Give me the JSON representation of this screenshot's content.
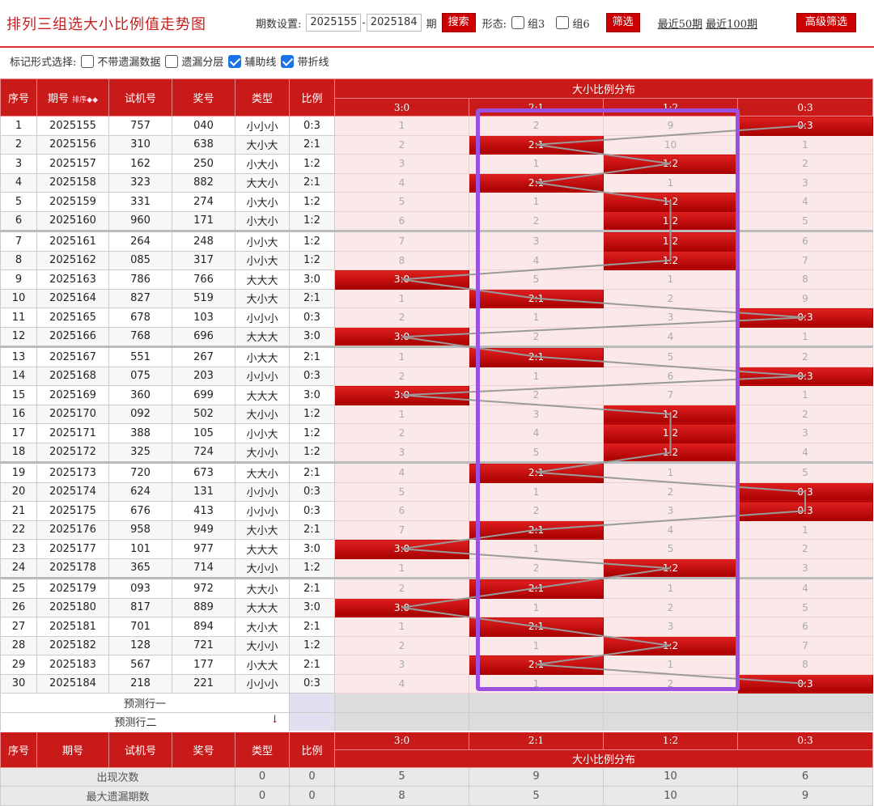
{
  "header": {
    "title": "排列三组选大小比例值走势图",
    "period_label": "期数设置:",
    "period_from": "2025155",
    "period_sep": "-",
    "period_to": "2025184",
    "period_unit": "期",
    "search_label": "搜索",
    "shape_label": "形态:",
    "group3_label": "组3",
    "group6_label": "组6",
    "filter_label": "筛选",
    "recent50_label": "最近50期",
    "recent100_label": "最近100期",
    "advanced_label": "高级筛选"
  },
  "options": {
    "label": "标记形式选择:",
    "items": [
      {
        "label": "不带遗漏数据",
        "checked": false
      },
      {
        "label": "遗漏分层",
        "checked": false
      },
      {
        "label": "辅助线",
        "checked": true
      },
      {
        "label": "带折线",
        "checked": true
      }
    ]
  },
  "columns": {
    "seq": "序号",
    "period": "期号",
    "sort": "排序",
    "test": "试机号",
    "draw": "奖号",
    "type": "类型",
    "ratio": "比例",
    "dist_title": "大小比例分布",
    "dist_cols": [
      "3:0",
      "2:1",
      "1:2",
      "0:3"
    ]
  },
  "rows": [
    {
      "seq": "1",
      "period": "2025155",
      "test": "757",
      "draw": "040",
      "type": "小小小",
      "ratio": "0:3",
      "dist": [
        "1",
        "2",
        "9",
        "0:3"
      ],
      "hit": 3
    },
    {
      "seq": "2",
      "period": "2025156",
      "test": "310",
      "draw": "638",
      "type": "大小大",
      "ratio": "2:1",
      "dist": [
        "2",
        "2:1",
        "10",
        "1"
      ],
      "hit": 1
    },
    {
      "seq": "3",
      "period": "2025157",
      "test": "162",
      "draw": "250",
      "type": "小大小",
      "ratio": "1:2",
      "dist": [
        "3",
        "1",
        "1:2",
        "2"
      ],
      "hit": 2
    },
    {
      "seq": "4",
      "period": "2025158",
      "test": "323",
      "draw": "882",
      "type": "大大小",
      "ratio": "2:1",
      "dist": [
        "4",
        "2:1",
        "1",
        "3"
      ],
      "hit": 1
    },
    {
      "seq": "5",
      "period": "2025159",
      "test": "331",
      "draw": "274",
      "type": "小大小",
      "ratio": "1:2",
      "dist": [
        "5",
        "1",
        "1:2",
        "4"
      ],
      "hit": 2
    },
    {
      "seq": "6",
      "period": "2025160",
      "test": "960",
      "draw": "171",
      "type": "小大小",
      "ratio": "1:2",
      "dist": [
        "6",
        "2",
        "1:2",
        "5"
      ],
      "hit": 2
    },
    {
      "seq": "7",
      "period": "2025161",
      "test": "264",
      "draw": "248",
      "type": "小小大",
      "ratio": "1:2",
      "dist": [
        "7",
        "3",
        "1:2",
        "6"
      ],
      "hit": 2
    },
    {
      "seq": "8",
      "period": "2025162",
      "test": "085",
      "draw": "317",
      "type": "小小大",
      "ratio": "1:2",
      "dist": [
        "8",
        "4",
        "1:2",
        "7"
      ],
      "hit": 2
    },
    {
      "seq": "9",
      "period": "2025163",
      "test": "786",
      "draw": "766",
      "type": "大大大",
      "ratio": "3:0",
      "dist": [
        "3:0",
        "5",
        "1",
        "8"
      ],
      "hit": 0
    },
    {
      "seq": "10",
      "period": "2025164",
      "test": "827",
      "draw": "519",
      "type": "大小大",
      "ratio": "2:1",
      "dist": [
        "1",
        "2:1",
        "2",
        "9"
      ],
      "hit": 1
    },
    {
      "seq": "11",
      "period": "2025165",
      "test": "678",
      "draw": "103",
      "type": "小小小",
      "ratio": "0:3",
      "dist": [
        "2",
        "1",
        "3",
        "0:3"
      ],
      "hit": 3
    },
    {
      "seq": "12",
      "period": "2025166",
      "test": "768",
      "draw": "696",
      "type": "大大大",
      "ratio": "3:0",
      "dist": [
        "3:0",
        "2",
        "4",
        "1"
      ],
      "hit": 0
    },
    {
      "seq": "13",
      "period": "2025167",
      "test": "551",
      "draw": "267",
      "type": "小大大",
      "ratio": "2:1",
      "dist": [
        "1",
        "2:1",
        "5",
        "2"
      ],
      "hit": 1
    },
    {
      "seq": "14",
      "period": "2025168",
      "test": "075",
      "draw": "203",
      "type": "小小小",
      "ratio": "0:3",
      "dist": [
        "2",
        "1",
        "6",
        "0:3"
      ],
      "hit": 3
    },
    {
      "seq": "15",
      "period": "2025169",
      "test": "360",
      "draw": "699",
      "type": "大大大",
      "ratio": "3:0",
      "dist": [
        "3:0",
        "2",
        "7",
        "1"
      ],
      "hit": 0
    },
    {
      "seq": "16",
      "period": "2025170",
      "test": "092",
      "draw": "502",
      "type": "大小小",
      "ratio": "1:2",
      "dist": [
        "1",
        "3",
        "1:2",
        "2"
      ],
      "hit": 2
    },
    {
      "seq": "17",
      "period": "2025171",
      "test": "388",
      "draw": "105",
      "type": "小小大",
      "ratio": "1:2",
      "dist": [
        "2",
        "4",
        "1:2",
        "3"
      ],
      "hit": 2
    },
    {
      "seq": "18",
      "period": "2025172",
      "test": "325",
      "draw": "724",
      "type": "大小小",
      "ratio": "1:2",
      "dist": [
        "3",
        "5",
        "1:2",
        "4"
      ],
      "hit": 2
    },
    {
      "seq": "19",
      "period": "2025173",
      "test": "720",
      "draw": "673",
      "type": "大大小",
      "ratio": "2:1",
      "dist": [
        "4",
        "2:1",
        "1",
        "5"
      ],
      "hit": 1
    },
    {
      "seq": "20",
      "period": "2025174",
      "test": "624",
      "draw": "131",
      "type": "小小小",
      "ratio": "0:3",
      "dist": [
        "5",
        "1",
        "2",
        "0:3"
      ],
      "hit": 3
    },
    {
      "seq": "21",
      "period": "2025175",
      "test": "676",
      "draw": "413",
      "type": "小小小",
      "ratio": "0:3",
      "dist": [
        "6",
        "2",
        "3",
        "0:3"
      ],
      "hit": 3
    },
    {
      "seq": "22",
      "period": "2025176",
      "test": "958",
      "draw": "949",
      "type": "大小大",
      "ratio": "2:1",
      "dist": [
        "7",
        "2:1",
        "4",
        "1"
      ],
      "hit": 1
    },
    {
      "seq": "23",
      "period": "2025177",
      "test": "101",
      "draw": "977",
      "type": "大大大",
      "ratio": "3:0",
      "dist": [
        "3:0",
        "1",
        "5",
        "2"
      ],
      "hit": 0
    },
    {
      "seq": "24",
      "period": "2025178",
      "test": "365",
      "draw": "714",
      "type": "大小小",
      "ratio": "1:2",
      "dist": [
        "1",
        "2",
        "1:2",
        "3"
      ],
      "hit": 2
    },
    {
      "seq": "25",
      "period": "2025179",
      "test": "093",
      "draw": "972",
      "type": "大大小",
      "ratio": "2:1",
      "dist": [
        "2",
        "2:1",
        "1",
        "4"
      ],
      "hit": 1
    },
    {
      "seq": "26",
      "period": "2025180",
      "test": "817",
      "draw": "889",
      "type": "大大大",
      "ratio": "3:0",
      "dist": [
        "3:0",
        "1",
        "2",
        "5"
      ],
      "hit": 0
    },
    {
      "seq": "27",
      "period": "2025181",
      "test": "701",
      "draw": "894",
      "type": "大小大",
      "ratio": "2:1",
      "dist": [
        "1",
        "2:1",
        "3",
        "6"
      ],
      "hit": 1
    },
    {
      "seq": "28",
      "period": "2025182",
      "test": "128",
      "draw": "721",
      "type": "大小小",
      "ratio": "1:2",
      "dist": [
        "2",
        "1",
        "1:2",
        "7"
      ],
      "hit": 2
    },
    {
      "seq": "29",
      "period": "2025183",
      "test": "567",
      "draw": "177",
      "type": "小大大",
      "ratio": "2:1",
      "dist": [
        "3",
        "2:1",
        "1",
        "8"
      ],
      "hit": 1
    },
    {
      "seq": "30",
      "period": "2025184",
      "test": "218",
      "draw": "221",
      "type": "小小小",
      "ratio": "0:3",
      "dist": [
        "4",
        "1",
        "2",
        "0:3"
      ],
      "hit": 3
    }
  ],
  "predict": {
    "row1": "预测行一",
    "row2": "预测行二",
    "arrow": "↓"
  },
  "stats": [
    {
      "label": "出现次数",
      "type": "0",
      "ratio": "0",
      "vals": [
        "5",
        "9",
        "10",
        "6"
      ]
    },
    {
      "label": "最大遗漏期数",
      "type": "0",
      "ratio": "0",
      "vals": [
        "8",
        "5",
        "10",
        "9"
      ]
    }
  ]
}
